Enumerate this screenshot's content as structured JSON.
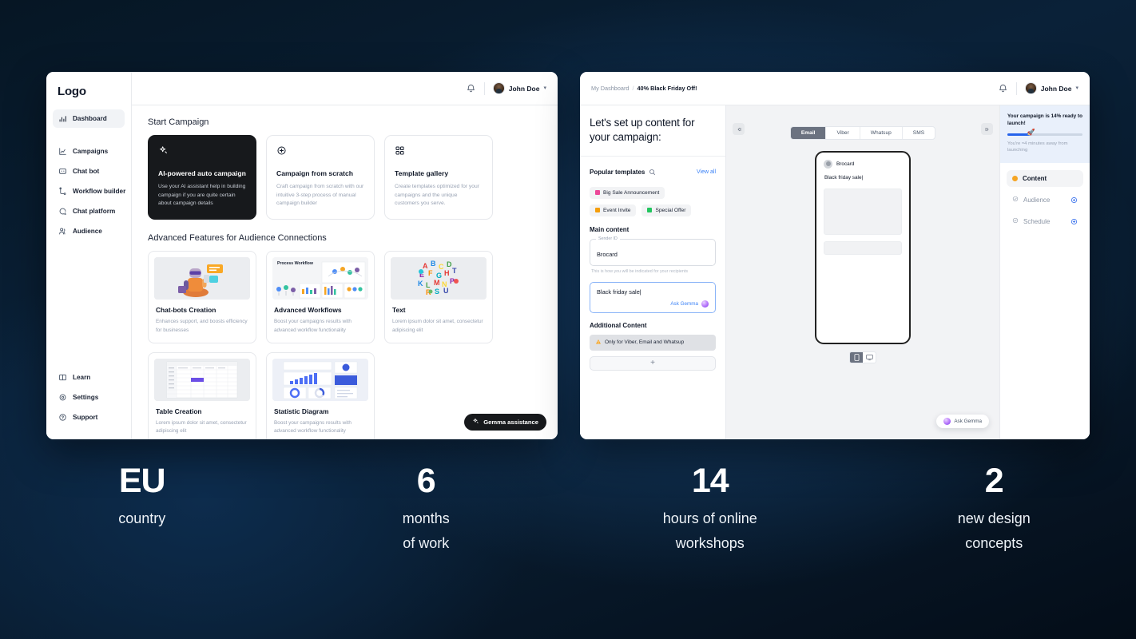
{
  "left_app": {
    "logo": "Logo",
    "nav_primary": [
      {
        "label": "Dashboard",
        "icon": "bar-chart-icon",
        "active": true
      }
    ],
    "nav_secondary": [
      {
        "label": "Campaigns",
        "icon": "line-chart-icon"
      },
      {
        "label": "Chat bot",
        "icon": "chat-bot-icon"
      },
      {
        "label": "Workflow builder",
        "icon": "workflow-icon"
      },
      {
        "label": "Chat platform",
        "icon": "chat-platform-icon"
      },
      {
        "label": "Audience",
        "icon": "audience-icon"
      }
    ],
    "nav_bottom": [
      {
        "label": "Learn",
        "icon": "book-icon"
      },
      {
        "label": "Settings",
        "icon": "gear-icon"
      },
      {
        "label": "Support",
        "icon": "help-circle-icon"
      }
    ],
    "topbar": {
      "bell": "notifications-bell-icon",
      "user_name": "John Doe",
      "caret": "▾"
    },
    "section_start": "Start Campaign",
    "start_cards": [
      {
        "title": "AI-powered auto campaign",
        "desc": "Use your AI assistant help in building campaign if you are  quite certain about campaign details",
        "icon": "sparkle-icon",
        "dark": true
      },
      {
        "title": "Campaign from scratch",
        "desc": "Craft campaign from scratch with our intuitive 3-step process of manual campaign builder",
        "icon": "plus-circle-icon",
        "dark": false
      },
      {
        "title": "Template gallery",
        "desc": "Create templates optimized for your campaigns and the unique customers you serve.",
        "icon": "grid-icon",
        "dark": false
      }
    ],
    "section_features": "Advanced Features for Audience Connections",
    "feature_cards_row1": [
      {
        "title": "Chat-bots Creation",
        "desc": "Enhances support, and boosts efficiency for businesses",
        "thumb": "robot-illustration"
      },
      {
        "title": "Advanced Workflows",
        "desc": "Boost your campaigns results with advanced workflow functionality",
        "thumb": "process-workflow-illustration",
        "thumb_label": "Process Workflow"
      },
      {
        "title": "Text",
        "desc": "Lorem ipsum dolor sit amet, consectetur adipiscing elit",
        "thumb": "letters-cloud-illustration"
      }
    ],
    "feature_cards_row2": [
      {
        "title": "Table Creation",
        "desc": "Lorem ipsum dolor sit amet, consectetur adipiscing elit",
        "thumb": "spreadsheet-illustration"
      },
      {
        "title": "Statistic Diagram",
        "desc": "Boost your campaigns results with advanced workflow functionality",
        "thumb": "dashboard-charts-illustration"
      }
    ],
    "gemma_pill": {
      "label": "Gemma assistance",
      "icon": "sparkle-icon"
    }
  },
  "right_app": {
    "breadcrumb": {
      "root": "My Dashboard",
      "sep": "/",
      "current": "40% Black Friday Off!"
    },
    "topbar": {
      "bell": "notifications-bell-icon",
      "user_name": "John Doe",
      "caret": "▾"
    },
    "heading": "Let's set up content for your campaign:",
    "templates": {
      "label": "Popular templates",
      "search_icon": "search-icon",
      "view_all": "View all",
      "items": [
        {
          "label": "Big Sale Announcement",
          "color": "#ec4899"
        },
        {
          "label": "Event Invite",
          "color": "#f59e0b"
        },
        {
          "label": "Special Offer",
          "color": "#22c55e"
        }
      ]
    },
    "main_content": {
      "label": "Main content",
      "sender_legend": "Sender ID",
      "sender_value": "Brocard",
      "sender_help": "This is how you will be indicated for your recipients",
      "body_value": "Black friday sale|",
      "ask_gemma": "Ask Gemma"
    },
    "additional_content": {
      "label": "Additional Content",
      "warning": "Only for Viber, Email and Whatsup",
      "warning_icon": "warning-triangle-icon",
      "add_label": "+"
    },
    "preview": {
      "collapse_left_icon": "collapse-left-icon",
      "collapse_right_icon": "collapse-right-icon",
      "channel_tabs": [
        {
          "label": "Email",
          "active": true
        },
        {
          "label": "Viber",
          "active": false
        },
        {
          "label": "Whatsup",
          "active": false
        },
        {
          "label": "SMS",
          "active": false
        }
      ],
      "phone": {
        "sender": "Brocard",
        "message": "Black friday sale|"
      },
      "device_toggle": [
        {
          "name": "mobile-view-icon",
          "active": true
        },
        {
          "name": "desktop-view-icon",
          "active": false
        }
      ],
      "ask_fab": "Ask Gemma"
    },
    "steps_panel": {
      "progress_title": "Your campaign is 14% ready to launch!",
      "progress_percent": 14,
      "progress_sub": "You're ≈4 minutes away from launching",
      "steps": [
        {
          "label": "Content",
          "state": "active",
          "marker": "dot-orange"
        },
        {
          "label": "Audience",
          "state": "pending",
          "marker": "check-circle-icon",
          "action": "add-circle-icon"
        },
        {
          "label": "Schedule",
          "state": "pending",
          "marker": "check-circle-icon",
          "action": "add-circle-icon"
        }
      ]
    }
  },
  "stats": [
    {
      "number": "EU",
      "label": "country"
    },
    {
      "number": "6",
      "label": "months\nof work"
    },
    {
      "number": "14",
      "label": "hours of online\nworkshops"
    },
    {
      "number": "2",
      "label": "new design\nconcepts"
    }
  ],
  "colors": {
    "accent_blue": "#2563eb",
    "link_blue": "#3b82f6",
    "dark_card": "#17191c",
    "amber": "#f5a524",
    "page_bg_dark": "#081a2c"
  }
}
